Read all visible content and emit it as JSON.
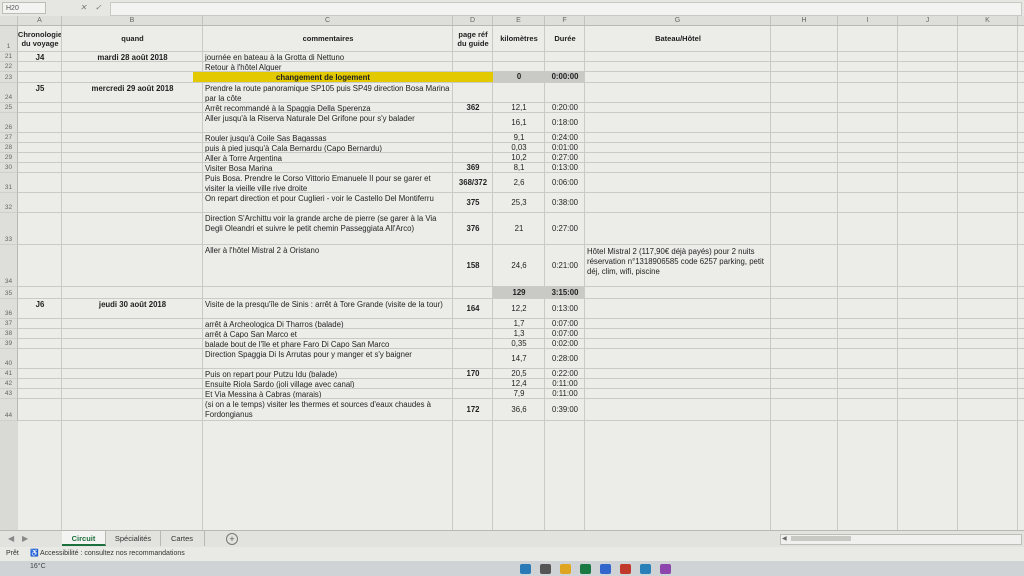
{
  "formula_bar": {
    "name_box": "H20",
    "fx": "✕ ✓ fx"
  },
  "columns": [
    "A",
    "B",
    "C",
    "D",
    "E",
    "F",
    "G",
    "H",
    "I",
    "J",
    "K",
    "L"
  ],
  "header_row": {
    "row": "1",
    "a": "Chronologie du voyage",
    "b": "quand",
    "c": "commentaires",
    "d": "page réf du guide",
    "e": "kilomètres",
    "f": "Durée",
    "g": "Bateau/Hôtel"
  },
  "rows": [
    {
      "row": "21",
      "a": "J4",
      "b": "mardi 28 août 2018",
      "c": "journée en bateau à la Grotta di Nettuno",
      "d": "",
      "e": "",
      "f": "",
      "g": ""
    },
    {
      "row": "22",
      "a": "",
      "b": "",
      "c": "Retour à l'hôtel Alguer",
      "d": "",
      "e": "",
      "f": "",
      "g": ""
    },
    {
      "row": "23",
      "a": "",
      "b": "",
      "c": "changement de logement",
      "d": "",
      "e": "0",
      "f": "0:00:00",
      "g": ""
    },
    {
      "row": "24",
      "a": "J5",
      "b": "mercredi 29 août 2018",
      "c": "Prendre la route panoramique SP105 puis SP49 direction Bosa Marina par la côte",
      "d": "",
      "e": "",
      "f": "",
      "g": ""
    },
    {
      "row": "25",
      "a": "",
      "b": "",
      "c": "Arrêt recommandé à la Spaggia Della Sperenza",
      "d": "362",
      "e": "12,1",
      "f": "0:20:00",
      "g": ""
    },
    {
      "row": "26",
      "a": "",
      "b": "",
      "c": "Aller jusqu'à la Riserva Naturale Del Grifone pour s'y balader",
      "d": "",
      "e": "16,1",
      "f": "0:18:00",
      "g": ""
    },
    {
      "row": "27",
      "a": "",
      "b": "",
      "c": "Rouler jusqu'à Coile Sas Bagassas",
      "d": "",
      "e": "9,1",
      "f": "0:24:00",
      "g": ""
    },
    {
      "row": "28",
      "a": "",
      "b": "",
      "c": "puis à pied jusqu'à Cala Bernardu (Capo Bernardu)",
      "d": "",
      "e": "0,03",
      "f": "0:01:00",
      "g": ""
    },
    {
      "row": "29",
      "a": "",
      "b": "",
      "c": "Aller à Torre Argentina",
      "d": "",
      "e": "10,2",
      "f": "0:27:00",
      "g": ""
    },
    {
      "row": "30",
      "a": "",
      "b": "",
      "c": "Visiter Bosa Marina",
      "d": "369",
      "e": "8,1",
      "f": "0:13:00",
      "g": ""
    },
    {
      "row": "31",
      "a": "",
      "b": "",
      "c": "Puis Bosa. Prendre le Corso Vittorio Emanuele II pour se garer et visiter la vieille ville rive droite",
      "d": "368/372",
      "e": "2,6",
      "f": "0:06:00",
      "g": ""
    },
    {
      "row": "32",
      "a": "",
      "b": "",
      "c": "On repart direction et pour Cuglieri - voir le Castello Del Montiferru",
      "d": "375",
      "e": "25,3",
      "f": "0:38:00",
      "g": ""
    },
    {
      "row": "33",
      "a": "",
      "b": "",
      "c": "Direction S'Archittu voir la grande arche de pierre (se garer à la Via Degli Oleandri et suivre le petit chemin Passeggiata All'Arco)",
      "d": "376",
      "e": "21",
      "f": "0:27:00",
      "g": ""
    },
    {
      "row": "34",
      "a": "",
      "b": "",
      "c": "Aller à l'hôtel Mistral 2 à Oristano",
      "d": "158",
      "e": "24,6",
      "f": "0:21:00",
      "g": "Hôtel Mistral 2 (117,90€ déjà payés) pour 2 nuits réservation n°1318906585 code 6257 parking, petit déj, clim, wifi, piscine"
    },
    {
      "row": "35",
      "a": "",
      "b": "",
      "c": "",
      "d": "",
      "e": "129",
      "f": "3:15:00",
      "g": ""
    },
    {
      "row": "36",
      "a": "J6",
      "b": "jeudi 30 août 2018",
      "c": "Visite de la presqu'île de Sinis : arrêt à Tore Grande (visite de la tour)",
      "d": "164",
      "e": "12,2",
      "f": "0:13:00",
      "g": ""
    },
    {
      "row": "37",
      "a": "",
      "b": "",
      "c": "arrêt à Archeologica Di Tharros (balade)",
      "d": "",
      "e": "1,7",
      "f": "0:07:00",
      "g": ""
    },
    {
      "row": "38",
      "a": "",
      "b": "",
      "c": "arrêt à Capo San Marco et",
      "d": "",
      "e": "1,3",
      "f": "0:07:00",
      "g": ""
    },
    {
      "row": "39",
      "a": "",
      "b": "",
      "c": "balade bout de l'île et phare Faro Di Capo San Marco",
      "d": "",
      "e": "0,35",
      "f": "0:02:00",
      "g": ""
    },
    {
      "row": "40",
      "a": "",
      "b": "",
      "c": "Direction Spaggia Di Is Arrutas pour y manger et s'y baigner",
      "d": "",
      "e": "14,7",
      "f": "0:28:00",
      "g": ""
    },
    {
      "row": "41",
      "a": "",
      "b": "",
      "c": "Puis on repart pour Putzu Idu (balade)",
      "d": "170",
      "e": "20,5",
      "f": "0:22:00",
      "g": ""
    },
    {
      "row": "42",
      "a": "",
      "b": "",
      "c": "Ensuite Riola Sardo (joli village avec canal)",
      "d": "",
      "e": "12,4",
      "f": "0:11:00",
      "g": ""
    },
    {
      "row": "43",
      "a": "",
      "b": "",
      "c": "Et Via Messina à Cabras (marais)",
      "d": "",
      "e": "7,9",
      "f": "0:11:00",
      "g": ""
    },
    {
      "row": "44",
      "a": "",
      "b": "",
      "c": "(si on a le temps) visiter les thermes et sources d'eaux chaudes à Fordongianus",
      "d": "172",
      "e": "36,6",
      "f": "0:39:00",
      "g": ""
    }
  ],
  "sheet_tabs": [
    "Circuit",
    "Spécialités",
    "Cartes"
  ],
  "active_tab": "Circuit",
  "status_bar": {
    "mode": "Prêt",
    "accessibility": "Accessibilité : consultez nos recommandations"
  },
  "taskbar": {
    "weather": "16°C"
  },
  "colors": {
    "highlight_yellow": "#e2c900",
    "highlight_grey": "#c9c9c5",
    "active_tab": "#1d6f3c"
  }
}
